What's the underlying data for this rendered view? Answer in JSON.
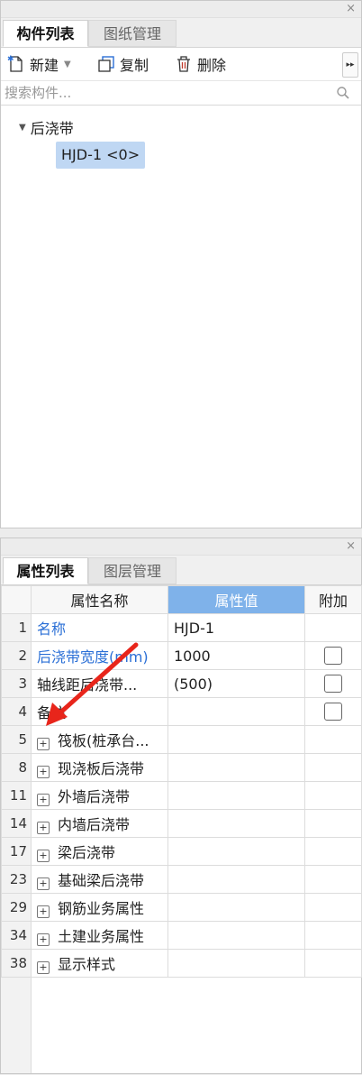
{
  "components_panel": {
    "close_label": "×",
    "tabs": [
      {
        "label": "构件列表",
        "active": true
      },
      {
        "label": "图纸管理",
        "active": false
      }
    ],
    "toolbar": {
      "new_label": "新建",
      "copy_label": "复制",
      "delete_label": "删除",
      "more_label": "▸▸"
    },
    "search": {
      "placeholder": "搜索构件..."
    },
    "tree": {
      "parent_label": "后浇带",
      "child_label": "HJD-1 <0>"
    }
  },
  "properties_panel": {
    "close_label": "×",
    "tabs": [
      {
        "label": "属性列表",
        "active": true
      },
      {
        "label": "图层管理",
        "active": false
      }
    ],
    "headers": {
      "name": "属性名称",
      "value": "属性值",
      "extra": "附加"
    },
    "rows": [
      {
        "num": "1",
        "name": "名称",
        "value": "HJD-1",
        "blue": true,
        "expandable": false,
        "checkbox": false
      },
      {
        "num": "2",
        "name": "后浇带宽度(mm)",
        "value": "1000",
        "blue": true,
        "expandable": false,
        "checkbox": true
      },
      {
        "num": "3",
        "name": "轴线距后浇带...",
        "value": "(500)",
        "blue": false,
        "expandable": false,
        "checkbox": true
      },
      {
        "num": "4",
        "name": "备注",
        "value": "",
        "blue": false,
        "expandable": false,
        "checkbox": true
      },
      {
        "num": "5",
        "name": "筏板(桩承台...",
        "value": "",
        "blue": false,
        "expandable": true,
        "checkbox": false
      },
      {
        "num": "8",
        "name": "现浇板后浇带",
        "value": "",
        "blue": false,
        "expandable": true,
        "checkbox": false
      },
      {
        "num": "11",
        "name": "外墙后浇带",
        "value": "",
        "blue": false,
        "expandable": true,
        "checkbox": false
      },
      {
        "num": "14",
        "name": "内墙后浇带",
        "value": "",
        "blue": false,
        "expandable": true,
        "checkbox": false
      },
      {
        "num": "17",
        "name": "梁后浇带",
        "value": "",
        "blue": false,
        "expandable": true,
        "checkbox": false
      },
      {
        "num": "23",
        "name": "基础梁后浇带",
        "value": "",
        "blue": false,
        "expandable": true,
        "checkbox": false
      },
      {
        "num": "29",
        "name": "钢筋业务属性",
        "value": "",
        "blue": false,
        "expandable": true,
        "checkbox": false
      },
      {
        "num": "34",
        "name": "土建业务属性",
        "value": "",
        "blue": false,
        "expandable": true,
        "checkbox": false
      },
      {
        "num": "38",
        "name": "显示样式",
        "value": "",
        "blue": false,
        "expandable": true,
        "checkbox": false
      }
    ],
    "expand_symbol": "+"
  },
  "colors": {
    "accent_header": "#7fb2ea",
    "selection": "#bfd7f3",
    "link_blue": "#2a6fd6",
    "annotation_arrow": "#e8251b"
  }
}
